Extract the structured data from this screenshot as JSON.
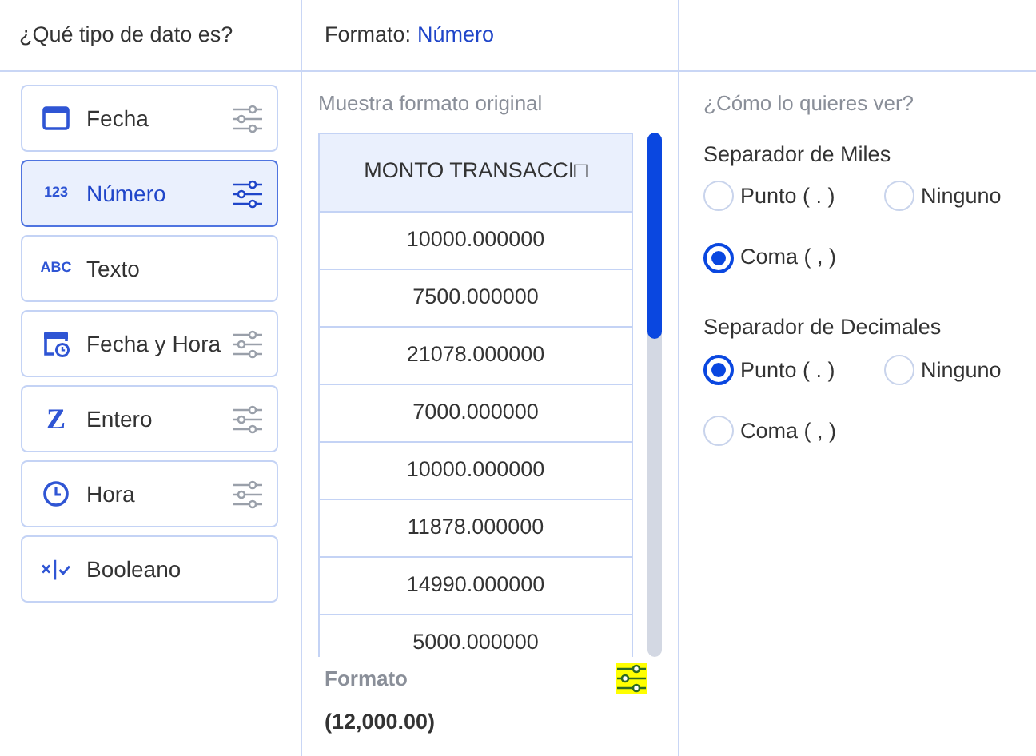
{
  "types_panel": {
    "title": "¿Qué tipo de dato es?",
    "items": [
      {
        "label": "Fecha",
        "kind": "calendar",
        "selected": false,
        "has_settings": true
      },
      {
        "label": "Número",
        "kind": "text",
        "icon_text": "123",
        "selected": true,
        "has_settings": true
      },
      {
        "label": "Texto",
        "kind": "text",
        "icon_text": "ABC",
        "selected": false,
        "has_settings": false
      },
      {
        "label": "Fecha y Hora",
        "kind": "calendar-clock",
        "selected": false,
        "has_settings": true
      },
      {
        "label": "Entero",
        "kind": "serif",
        "icon_text": "Z",
        "selected": false,
        "has_settings": true
      },
      {
        "label": "Hora",
        "kind": "clock",
        "selected": false,
        "has_settings": true
      },
      {
        "label": "Booleano",
        "kind": "boolean",
        "selected": false,
        "has_settings": false
      }
    ]
  },
  "format_header": {
    "label": "Formato:",
    "value": "Número"
  },
  "sample": {
    "title": "Muestra formato original",
    "column": "MONTO TRANSACCI□",
    "rows": [
      "10000.000000",
      "7500.000000",
      "21078.000000",
      "7000.000000",
      "10000.000000",
      "11878.000000",
      "14990.000000",
      "5000.000000"
    ]
  },
  "format": {
    "label": "Formato",
    "value": "(12,000.00)",
    "settings_highlighted": true
  },
  "view_panel": {
    "title": "¿Cómo lo quieres ver?",
    "groups": [
      {
        "title": "Separador de Miles",
        "options": [
          {
            "label": "Punto ( . )",
            "selected": false
          },
          {
            "label": "Ninguno",
            "selected": false
          },
          {
            "label": "Coma ( , )",
            "selected": true
          }
        ]
      },
      {
        "title": "Separador de Decimales",
        "options": [
          {
            "label": "Punto ( . )",
            "selected": true
          },
          {
            "label": "Ninguno",
            "selected": false
          },
          {
            "label": "Coma ( , )",
            "selected": false
          }
        ]
      }
    ]
  }
}
